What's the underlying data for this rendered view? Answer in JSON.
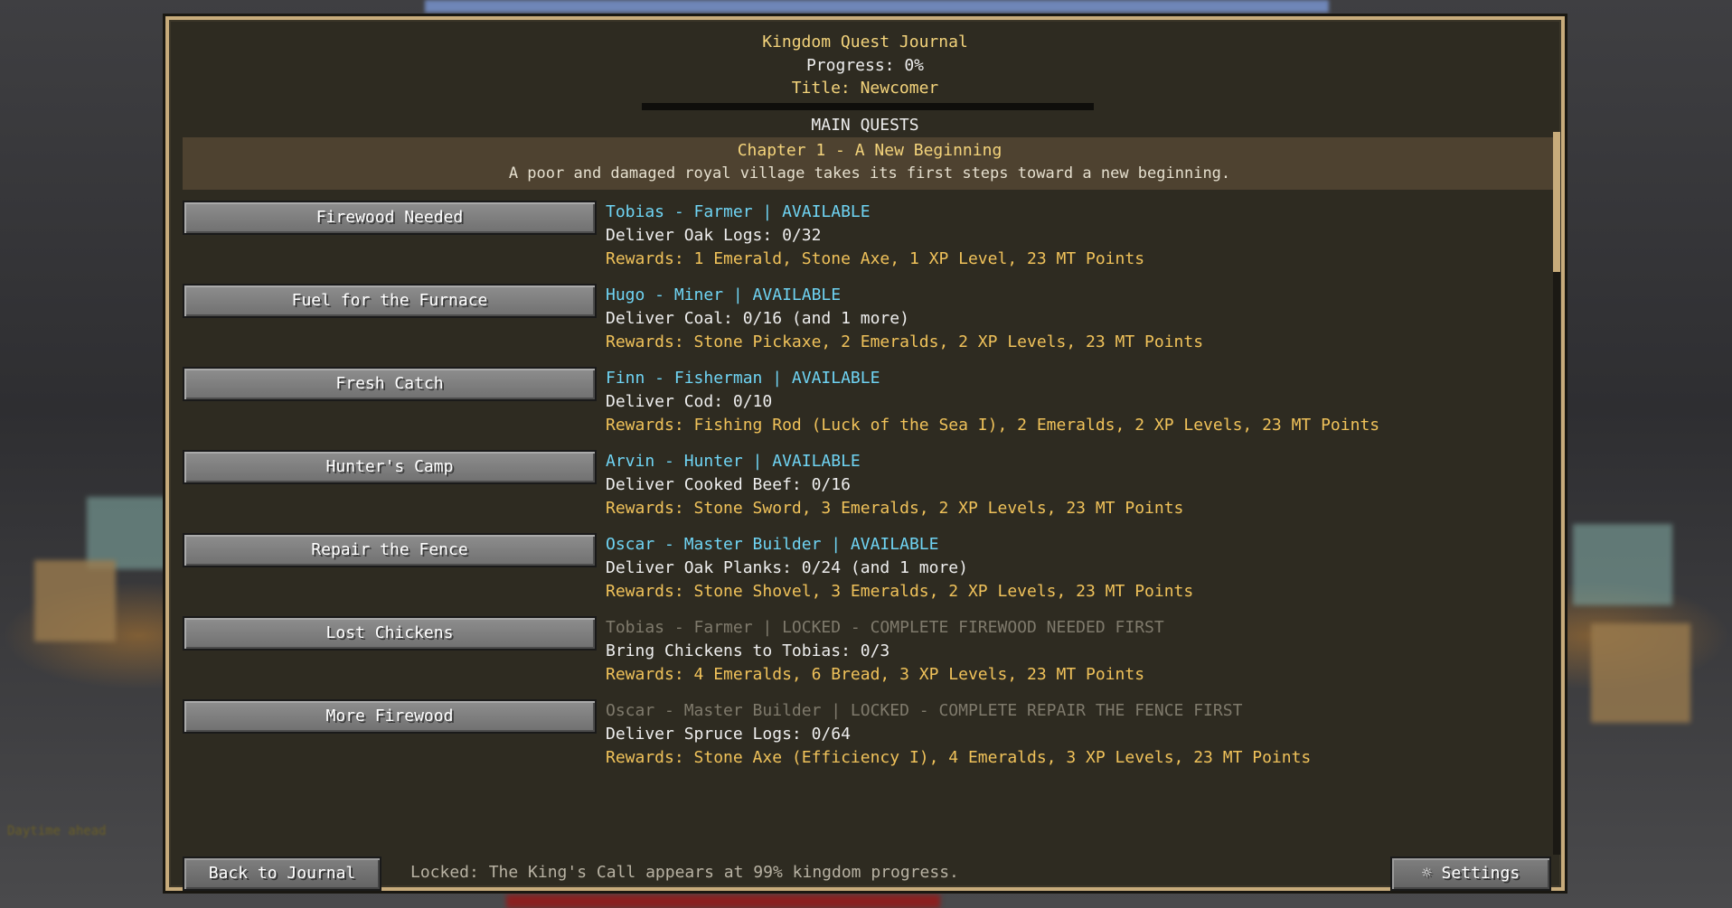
{
  "journal": {
    "title": "Kingdom Quest Journal",
    "progress": "Progress: 0%",
    "rank": "Title: Newcomer",
    "section": "MAIN QUESTS"
  },
  "chapter": {
    "title": "Chapter 1 - A New Beginning",
    "description": "A poor and damaged royal village takes its first steps toward a new beginning."
  },
  "quests": [
    {
      "button": "Firewood Needed",
      "giver": "Tobias - Farmer | AVAILABLE",
      "task": "Deliver Oak Logs: 0/32",
      "rewards": "Rewards: 1 Emerald, Stone Axe, 1 XP Level, 23 MT Points"
    },
    {
      "button": "Fuel for the Furnace",
      "giver": "Hugo - Miner | AVAILABLE",
      "task": "Deliver Coal: 0/16 (and 1 more)",
      "rewards": "Rewards: Stone Pickaxe, 2 Emeralds, 2 XP Levels, 23 MT Points"
    },
    {
      "button": "Fresh Catch",
      "giver": "Finn - Fisherman | AVAILABLE",
      "task": "Deliver Cod: 0/10",
      "rewards": "Rewards: Fishing Rod (Luck of the Sea I), 2 Emeralds, 2 XP Levels, 23 MT Points"
    },
    {
      "button": "Hunter's Camp",
      "giver": "Arvin - Hunter | AVAILABLE",
      "task": "Deliver Cooked Beef: 0/16",
      "rewards": "Rewards: Stone Sword, 3 Emeralds, 2 XP Levels, 23 MT Points"
    },
    {
      "button": "Repair the Fence",
      "giver": "Oscar - Master Builder | AVAILABLE",
      "task": "Deliver Oak Planks: 0/24 (and 1 more)",
      "rewards": "Rewards: Stone Shovel, 3 Emeralds, 2 XP Levels, 23 MT Points"
    },
    {
      "button": "Lost Chickens",
      "giver": "Tobias - Farmer | LOCKED - COMPLETE FIREWOOD NEEDED FIRST",
      "task": "Bring Chickens to Tobias: 0/3",
      "rewards": "Rewards: 4 Emeralds, 6 Bread, 3 XP Levels, 23 MT Points"
    },
    {
      "button": "More Firewood",
      "giver": "Oscar - Master Builder | LOCKED - COMPLETE REPAIR THE FENCE FIRST",
      "task": "Deliver Spruce Logs: 0/64",
      "rewards": "Rewards: Stone Axe (Efficiency I), 4 Emeralds, 3 XP Levels, 23 MT Points"
    }
  ],
  "footer": {
    "back_label": "Back to Journal",
    "note": "Locked: The King's Call appears at 99% kingdom progress.",
    "settings_label": "☼ Settings"
  },
  "background": {
    "hint": "Daytime ahead"
  },
  "colors": {
    "panel_bg": "#2e2b21",
    "panel_border": "#c7ab7b",
    "gold_text": "#f3d37b",
    "available_giver": "#6fd4f4",
    "locked_giver": "#7f7a6c",
    "reward_text": "#f0c25a"
  }
}
